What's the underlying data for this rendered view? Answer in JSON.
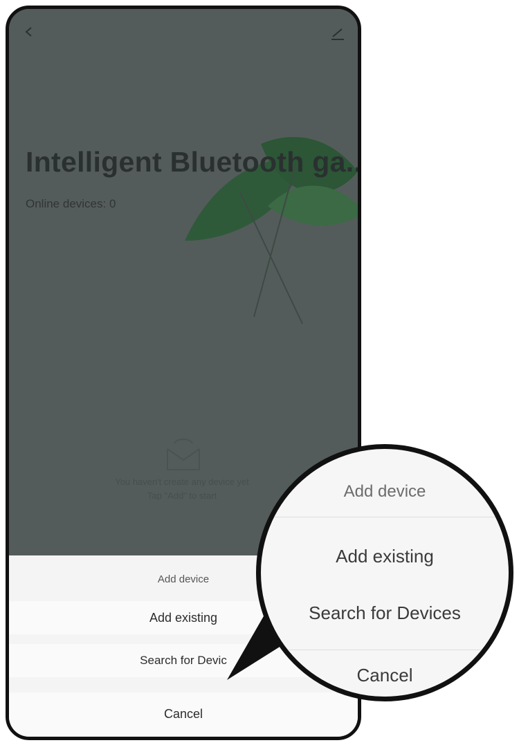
{
  "header": {
    "back_icon": "chevron-left-icon",
    "edit_icon": "pencil-icon"
  },
  "home": {
    "title": "Intelligent Bluetooth ga...",
    "online_devices": "Online devices: 0"
  },
  "empty_state": {
    "icon": "inbox-icon",
    "line1": "You haven't create any device yet",
    "line2": "Tap \"Add\" to start"
  },
  "action_sheet": {
    "title": "Add device",
    "add_existing": "Add existing",
    "search_devices": "Search for Devic",
    "cancel": "Cancel"
  },
  "magnifier": {
    "title": "Add device",
    "add_existing": "Add existing",
    "search_devices": "Search for Devices",
    "cancel": "Cancel"
  },
  "colors": {
    "overlay": "#545c5b",
    "sheet": "#f4f4f4",
    "frame": "#111111"
  }
}
